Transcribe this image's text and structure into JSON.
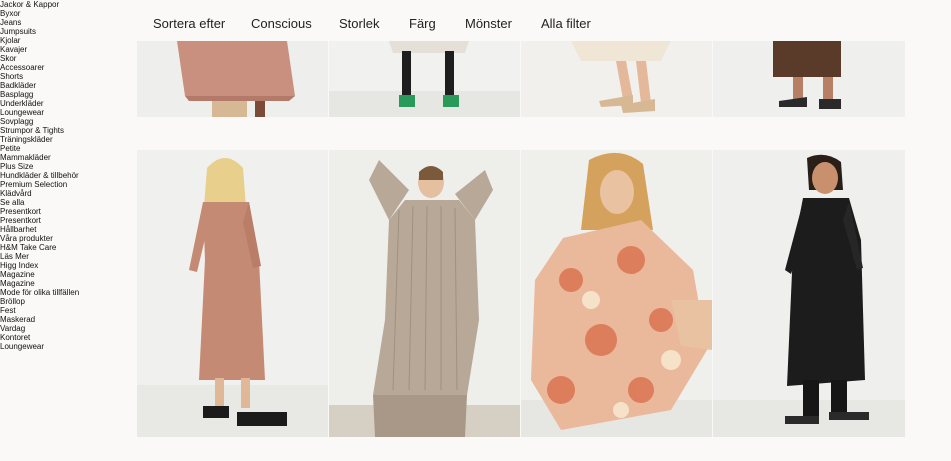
{
  "sidebar": {
    "items": [
      "Jackor & Kappor",
      "Byxor",
      "Jeans",
      "Jumpsuits",
      "Kjolar",
      "Kavajer",
      "Skor",
      "Accessoarer",
      "Shorts",
      "Badkläder",
      "Basplagg",
      "Underkläder",
      "Loungewear",
      "Sovplagg",
      "Strumpor & Tights",
      "Träningskläder",
      "Petite",
      "Mammakläder",
      "Plus Size",
      "Hundkläder & tillbehör",
      "Premium Selection",
      "Klädvård",
      "Se alla",
      "Presentkort",
      "Presentkort",
      "Hållbarhet",
      "Våra produkter",
      "H&M Take Care",
      "Läs Mer",
      "Higg Index",
      "Magazine",
      "Magazine",
      "Mode för olika tillfällen",
      "Bröllop",
      "Fest",
      "Maskerad",
      "Vardag",
      "Kontoret",
      "Loungewear"
    ]
  },
  "filters": {
    "sort": "Sortera efter",
    "conscious": "Conscious",
    "size": "Storlek",
    "color": "Färg",
    "pattern": "Mönster",
    "all": "Alla filter"
  },
  "products_top": [
    {
      "image": "pink-dress-legs-photo",
      "dress_color": "#c9907f"
    },
    {
      "image": "white-dress-green-sandals-photo",
      "dress_color": "#e8e4de"
    },
    {
      "image": "cream-dress-heeled-sandals-photo",
      "dress_color": "#efe6d6"
    },
    {
      "image": "brown-dress-flip-flops-photo",
      "dress_color": "#5a3a28"
    }
  ],
  "products_bottom": [
    {
      "image": "pink-wrap-dress-photo",
      "dress_color": "#c48a74"
    },
    {
      "image": "beige-knit-dress-photo",
      "dress_color": "#b8a898"
    },
    {
      "image": "floral-dress-photo",
      "dress_color": "#eab89a"
    },
    {
      "image": "black-shirt-dress-photo",
      "dress_color": "#1c1c1c"
    }
  ],
  "colors": {
    "background": "#faf9f8",
    "tile_background": "#eeeeec",
    "text": "#222222"
  }
}
